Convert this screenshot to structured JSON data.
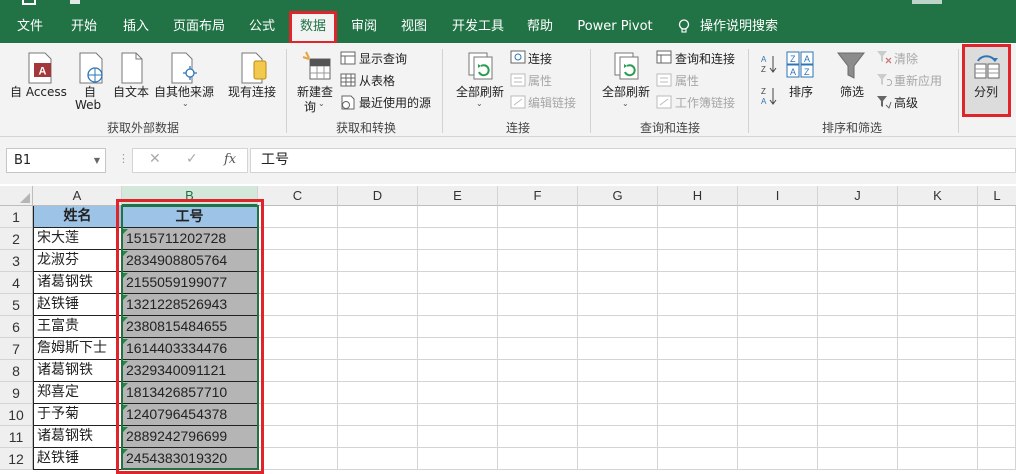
{
  "tabs": [
    "文件",
    "开始",
    "插入",
    "页面布局",
    "公式",
    "数据",
    "审阅",
    "视图",
    "开发工具",
    "帮助",
    "Power Pivot",
    "操作说明搜索"
  ],
  "ribbon": {
    "external": {
      "access": "自 Access",
      "web_1": "自",
      "web_2": "Web",
      "text": "自文本",
      "other": "自其他来源",
      "existing": "现有连接",
      "group": "获取外部数据"
    },
    "transform": {
      "new_query_1": "新建查",
      "new_query_2": "询",
      "show_queries": "显示查询",
      "from_table": "从表格",
      "recent_sources": "最近使用的源",
      "group": "获取和转换"
    },
    "connections": {
      "refresh_all": "全部刷新",
      "connections": "连接",
      "properties": "属性",
      "edit_links": "编辑链接",
      "group": "连接"
    },
    "query_conn": {
      "refresh_all": "全部刷新",
      "queries_connections": "查询和连接",
      "properties": "属性",
      "workbook_links": "工作簿链接",
      "group": "查询和连接"
    },
    "sort_filter": {
      "sort": "排序",
      "filter": "筛选",
      "clear": "清除",
      "reapply": "重新应用",
      "advanced": "高级",
      "group": "排序和筛选"
    },
    "split": "分列"
  },
  "formula_bar": {
    "name_box": "B1",
    "cancel": "✕",
    "enter": "✓",
    "fx": "fx",
    "content": "工号"
  },
  "columns": [
    "A",
    "B",
    "C",
    "D",
    "E",
    "F",
    "G",
    "H",
    "I",
    "J",
    "K",
    "L"
  ],
  "rows": [
    "1",
    "2",
    "3",
    "4",
    "5",
    "6",
    "7",
    "8",
    "9",
    "10",
    "11",
    "12"
  ],
  "table": {
    "header": [
      "姓名",
      "工号"
    ],
    "data": [
      [
        "宋大莲",
        "1515711202728"
      ],
      [
        "龙淑芬",
        "2834908805764"
      ],
      [
        "诸葛钢铁",
        "2155059199077"
      ],
      [
        "赵铁锤",
        "1321228526943"
      ],
      [
        "王富贵",
        "2380815484655"
      ],
      [
        "詹姆斯下士",
        "1614403334476"
      ],
      [
        "诸葛钢铁",
        "2329340091121"
      ],
      [
        "郑喜定",
        "1813426857710"
      ],
      [
        "于予菊",
        "1240796454378"
      ],
      [
        "诸葛钢铁",
        "2889242796699"
      ],
      [
        "赵铁锤",
        "2454383019320"
      ]
    ]
  },
  "colors": {
    "excel_green": "#217346",
    "highlight_red": "#e0242c",
    "header_fill": "#9dc3e6",
    "id_fill": "#b5b5b5"
  }
}
